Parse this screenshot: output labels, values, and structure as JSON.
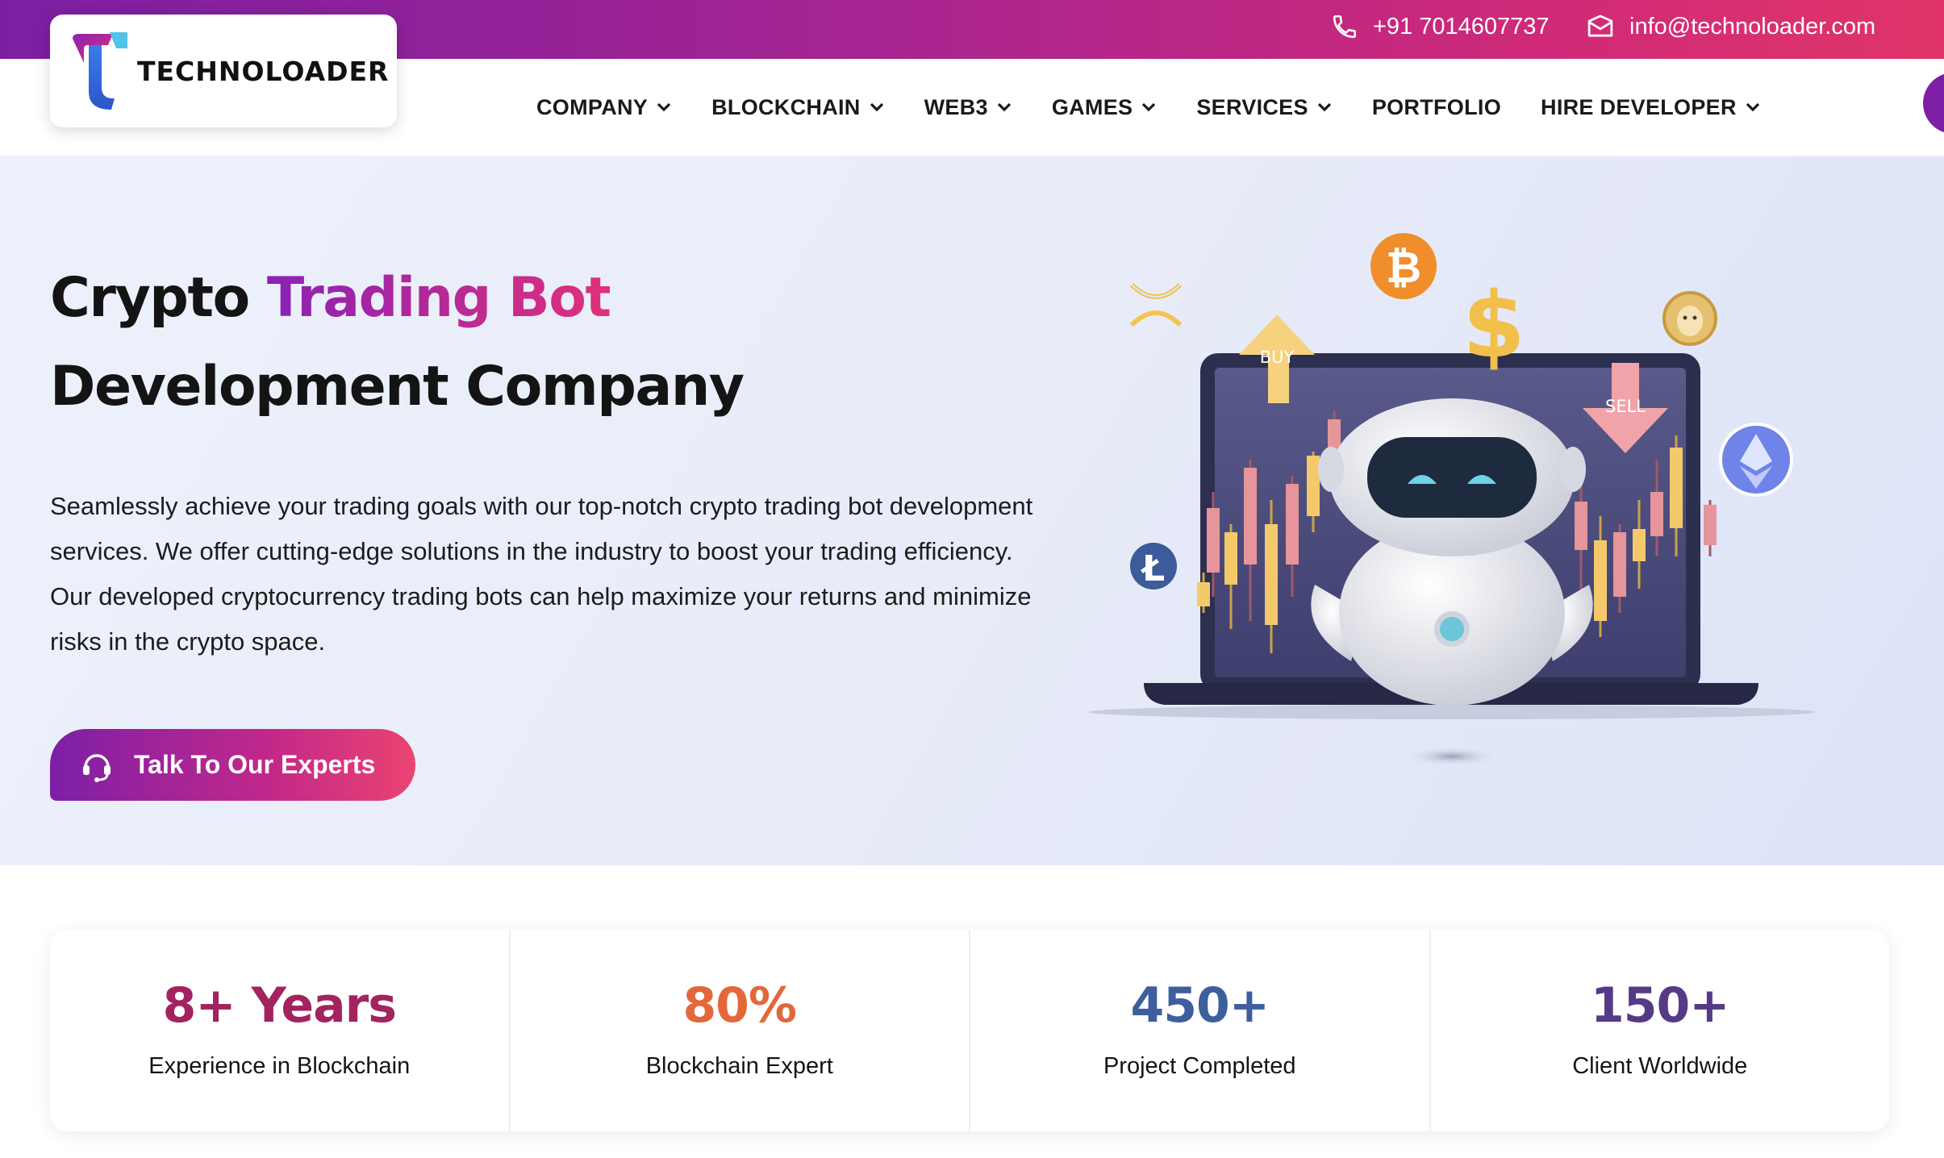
{
  "contact": {
    "phone": "+91 7014607737",
    "email": "info@technoloader.com"
  },
  "logo": {
    "text": "TECHNOLOADER"
  },
  "nav": [
    {
      "label": "COMPANY",
      "dropdown": true
    },
    {
      "label": "BLOCKCHAIN",
      "dropdown": true
    },
    {
      "label": "WEB3",
      "dropdown": true
    },
    {
      "label": "GAMES",
      "dropdown": true
    },
    {
      "label": "SERVICES",
      "dropdown": true
    },
    {
      "label": "PORTFOLIO",
      "dropdown": false
    },
    {
      "label": "HIRE DEVELOPER",
      "dropdown": true
    }
  ],
  "hero": {
    "title_part1": "Crypto ",
    "title_highlight": "Trading Bot",
    "title_line2": "Development Company",
    "description": "Seamlessly achieve your trading goals with our top-notch crypto trading bot development services. We offer cutting-edge solutions in the industry to boost your trading efficiency. Our developed cryptocurrency trading bots can help maximize your returns and minimize risks in the crypto space.",
    "cta_label": "Talk To Our Experts",
    "illustration": {
      "buy_label": "BUY",
      "sell_label": "SELL"
    }
  },
  "stats": [
    {
      "value": "8+ Years",
      "label": "Experience in Blockchain",
      "color": "#a2235f"
    },
    {
      "value": "80%",
      "label": "Blockchain Expert",
      "color": "#e2683a"
    },
    {
      "value": "450+",
      "label": "Project Completed",
      "color": "#3d5f9e"
    },
    {
      "value": "150+",
      "label": "Client Worldwide",
      "color": "#563a86"
    }
  ],
  "colors": {
    "brand_purple": "#7b1fa2",
    "brand_pink": "#e03468",
    "hero_bg": "#e8ecf8"
  }
}
